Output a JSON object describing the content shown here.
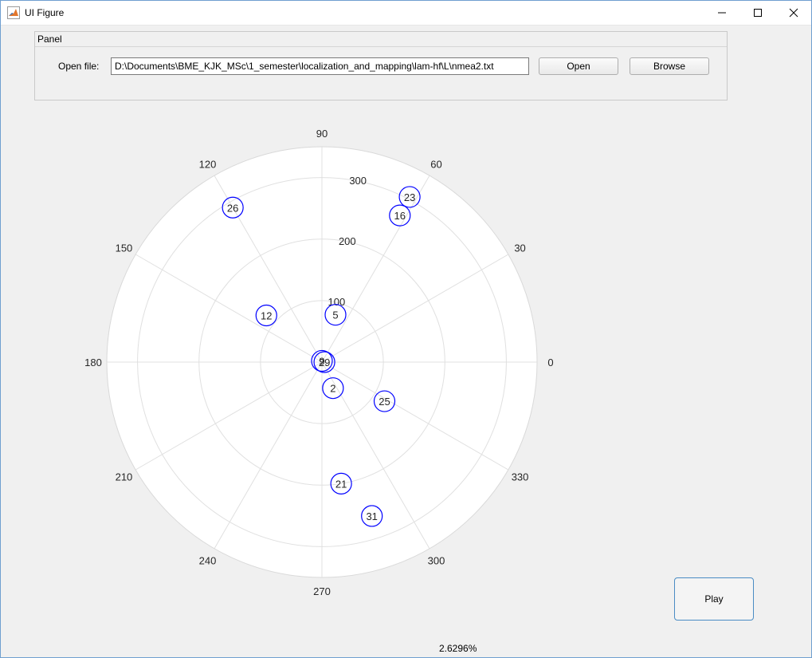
{
  "window": {
    "title": "UI Figure"
  },
  "panel": {
    "title": "Panel",
    "open_file_label": "Open file:",
    "file_path": "D:\\Documents\\BME_KJK_MSc\\1_semester\\localization_and_mapping\\lam-hf\\L\\nmea2.txt",
    "open_button": "Open",
    "browse_button": "Browse"
  },
  "polar_plot": {
    "theta_ticks": [
      "0",
      "30",
      "60",
      "90",
      "120",
      "150",
      "180",
      "210",
      "240",
      "270",
      "300",
      "330"
    ],
    "r_ticks": [
      "100",
      "200",
      "300"
    ],
    "r_max": 350,
    "satellites": [
      {
        "id": "26",
        "theta": 120,
        "r": 290
      },
      {
        "id": "23",
        "theta": 62,
        "r": 304
      },
      {
        "id": "16",
        "theta": 62,
        "r": 270
      },
      {
        "id": "12",
        "theta": 140,
        "r": 118
      },
      {
        "id": "5",
        "theta": 74,
        "r": 80
      },
      {
        "id": "9",
        "theta": 90,
        "r": 2
      },
      {
        "id": "29",
        "theta": 0,
        "r": 4
      },
      {
        "id": "2",
        "theta": 293,
        "r": 46
      },
      {
        "id": "25",
        "theta": 328,
        "r": 120
      },
      {
        "id": "21",
        "theta": 279,
        "r": 200
      },
      {
        "id": "31",
        "theta": 288,
        "r": 263
      }
    ],
    "marker_color": "#0000ff"
  },
  "play_button": "Play",
  "progress_text": "2.6296%"
}
